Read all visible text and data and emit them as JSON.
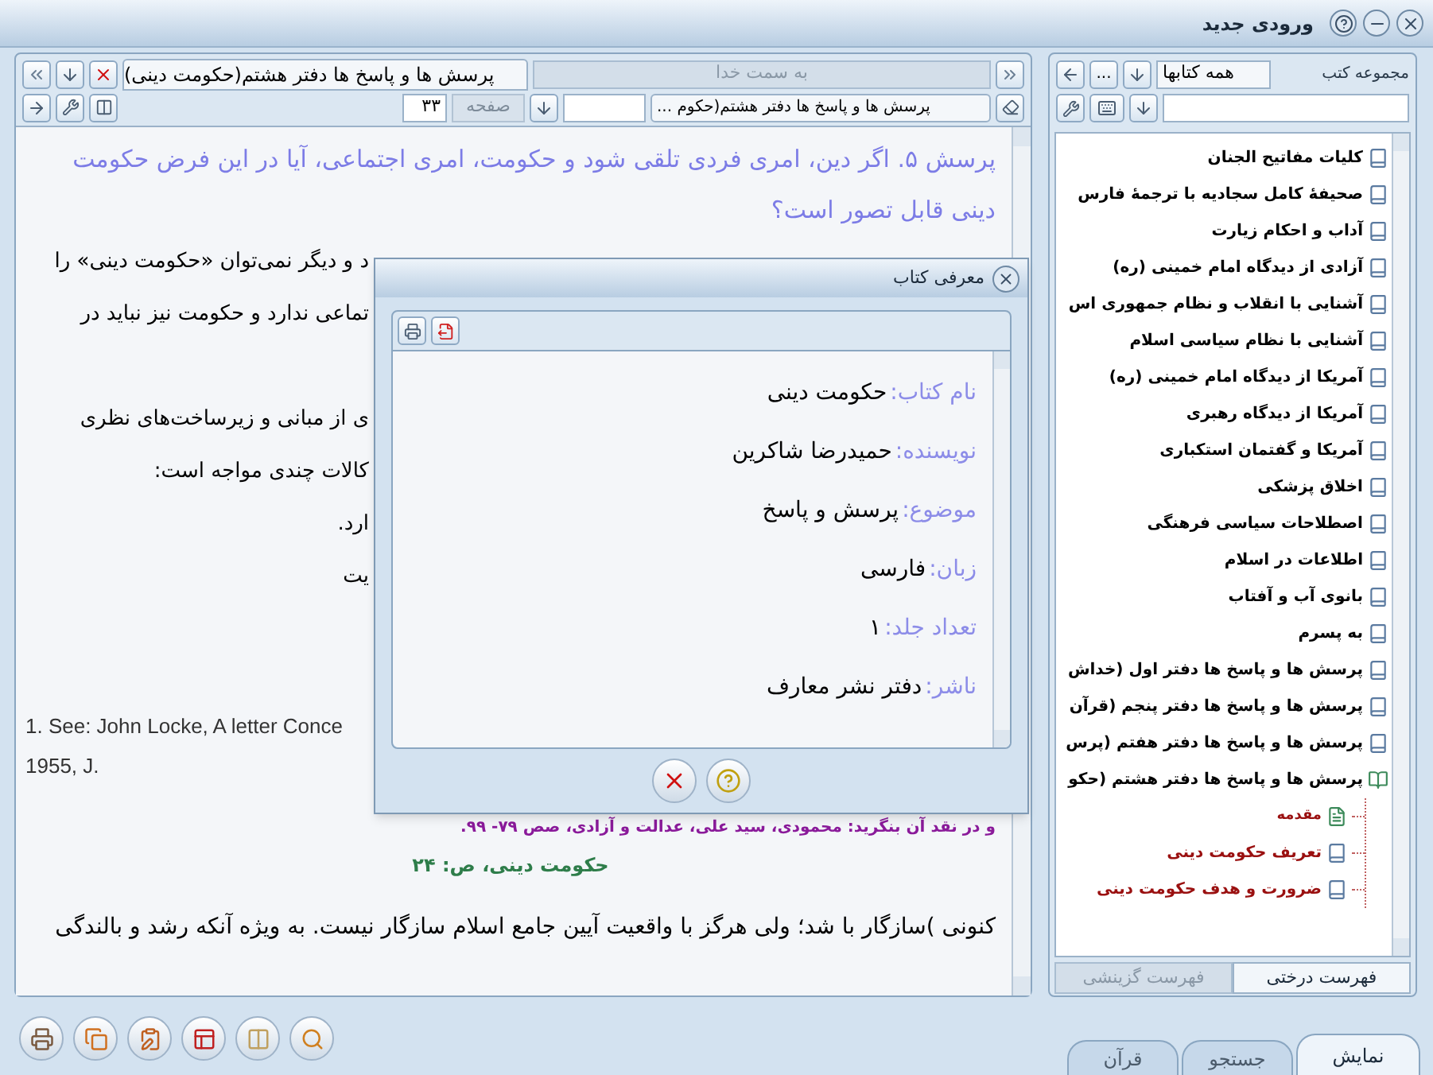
{
  "window": {
    "title": "ورودی جدید"
  },
  "reader": {
    "tab": {
      "title": "پرسش ها و پاسخ ها دفتر هشتم(حکومت دینی)"
    },
    "other_tab": {
      "title": "به سمت خدا"
    },
    "book_select": {
      "value": "پرسش ها و پاسخ ها دفتر هشتم(حکوم ..."
    },
    "page": {
      "label": "صفحه",
      "value": "۳۳"
    },
    "question": "پرسش ۵. اگر دین، امری فردی تلقی شود و حکومت، امری اجتماعی، آیا در این فرض حکومت دینی قابل تصور است؟",
    "partial_paragraphs": [
      [
        "د و دیگر نمی‌توان «حکومت دینی» را",
        "تماعی ندارد و حکومت نیز نباید در"
      ],
      [
        "ی از مبانی و زیرساخت‌های نظری",
        "کالات چندی مواجه است:",
        "ارد.",
        "یت"
      ]
    ],
    "footnotes": [
      "1. See: John Locke, A letter Conce",
      "1955, J."
    ],
    "footnote_fa": "و در نقد آن بنگرید: محمودی، سید علی، عدالت و آزادی، صص ۷۹- ۹۹.",
    "page_marker": "حکومت دینی، ص: ۲۴",
    "paragraph": "کنونی )سازگار با شد؛ ولی هرگز با واقعیت آیین جامع اسلام سازگار نیست. به ویژه آنکه رشد و بالندگی"
  },
  "dialog": {
    "title": "معرفی کتاب",
    "fields": [
      {
        "label": "نام کتاب:",
        "value": "حکومت دینی"
      },
      {
        "label": "نویسنده:",
        "value": "حمیدرضا شاکرین"
      },
      {
        "label": "موضوع:",
        "value": "پرسش و پاسخ"
      },
      {
        "label": "زبان:",
        "value": "فارسی"
      },
      {
        "label": "تعداد جلد:",
        "value": "۱"
      },
      {
        "label": "ناشر:",
        "value": "دفتر نشر معارف"
      }
    ]
  },
  "library": {
    "label": "مجموعه کتب",
    "collection": "همه کتابها",
    "more_button": "...",
    "books": [
      {
        "title": "کلیات مفاتیح الجنان",
        "expanded": false
      },
      {
        "title": "صحیفهٔ کامل سجادیه با ترجمهٔ فارس",
        "expanded": false
      },
      {
        "title": "آداب و احکام زیارت",
        "expanded": false
      },
      {
        "title": "آزادی از دیدگاه امام خمینی (ره)",
        "expanded": false
      },
      {
        "title": "آشنایی با انقلاب و نظام جمهوری اس",
        "expanded": false
      },
      {
        "title": "آشنایی با نظام سیاسی اسلام",
        "expanded": false
      },
      {
        "title": "آمریکا از دیدگاه امام خمینی (ره)",
        "expanded": false
      },
      {
        "title": "آمریکا از دیدگاه رهبری",
        "expanded": false
      },
      {
        "title": "آمریکا و گفتمان استکباری",
        "expanded": false
      },
      {
        "title": "اخلاق پزشکی",
        "expanded": false
      },
      {
        "title": "اصطلاحات سیاسی فرهنگی",
        "expanded": false
      },
      {
        "title": "اطلاعات در اسلام",
        "expanded": false
      },
      {
        "title": "بانوی آب و آفتاب",
        "expanded": false
      },
      {
        "title": "به پسرم",
        "expanded": false
      },
      {
        "title": "پرسش ها و پاسخ ها دفتر اول (خداش",
        "expanded": false
      },
      {
        "title": "پرسش ها و پاسخ ها دفتر پنجم (قرآن",
        "expanded": false
      },
      {
        "title": "پرسش ها و پاسخ ها دفتر هفتم (پرس",
        "expanded": false
      },
      {
        "title": "پرسش ها و پاسخ ها دفتر هشتم (حکو",
        "expanded": true,
        "children": [
          {
            "title": "مقدمه",
            "kind": "page"
          },
          {
            "title": "تعریف حکومت دینی",
            "kind": "section"
          },
          {
            "title": "ضرورت و هدف حکومت دینی",
            "kind": "section"
          }
        ]
      }
    ],
    "tabs": [
      {
        "label": "فهرست درختی",
        "selected": true
      },
      {
        "label": "فهرست گزینشی",
        "selected": false
      }
    ]
  },
  "bottom_tabs": [
    {
      "label": "نمایش",
      "selected": true
    },
    {
      "label": "جستجو",
      "selected": false
    },
    {
      "label": "قرآن",
      "selected": false
    }
  ]
}
